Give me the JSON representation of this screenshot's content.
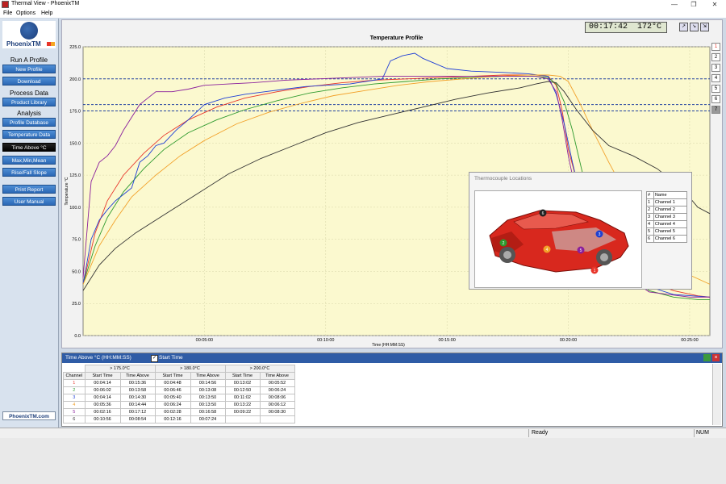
{
  "window": {
    "title": "Thermal View - PhoenixTM",
    "minimize": "—",
    "restore": "❐",
    "close": "✕"
  },
  "menu": [
    "File",
    "Options",
    "Help"
  ],
  "sidebar": {
    "brand": "PhoenixTM",
    "sections": [
      {
        "heading": "Run A Profile",
        "buttons": [
          "New Profile",
          "Download"
        ]
      },
      {
        "heading": "Process Data",
        "buttons": [
          "Product Library"
        ]
      },
      {
        "heading": "Analysis",
        "buttons": [
          "Profile Database",
          "Temperature Data",
          "Time Above °C",
          "Max,Min,Mean",
          "Rise/Fall Slope"
        ]
      },
      {
        "heading": "",
        "buttons": [
          "Print Report",
          "User Manual"
        ]
      }
    ],
    "active_button": "Time Above °C",
    "footer_link": "PhoenixTM.com"
  },
  "readout": {
    "time": "00:17:42",
    "temp": "172°C"
  },
  "channel_buttons": [
    "1",
    "2",
    "3",
    "4",
    "5",
    "6",
    "7"
  ],
  "colors": {
    "ch1": "#e8352a",
    "ch2": "#2e9a2e",
    "ch3": "#1f3fd6",
    "ch4": "#f2a12a",
    "ch5": "#8a1f9c",
    "ch6": "#333333",
    "plot_bg": "#fbf9cf",
    "limit": "#2040a0"
  },
  "chart_data": {
    "type": "line",
    "title": "Temperature Profile",
    "xlabel": "Time (HH:MM:SS)",
    "ylabel": "Temperature °C",
    "xlim": [
      0,
      1550
    ],
    "ylim": [
      0,
      225
    ],
    "x_ticks": [
      "00:05:00",
      "00:10:00",
      "00:15:00",
      "00:20:00",
      "00:25:00"
    ],
    "x_tick_values": [
      300,
      600,
      900,
      1200,
      1500
    ],
    "y_ticks": [
      "0.0",
      "25.0",
      "50.0",
      "75.0",
      "100.0",
      "125.0",
      "150.0",
      "175.0",
      "200.0",
      "225.0"
    ],
    "grid": true,
    "limit_lines": [
      175,
      180,
      200
    ],
    "series": [
      {
        "name": "Channel 1",
        "x": [
          0,
          30,
          60,
          100,
          150,
          200,
          260,
          330,
          400,
          480,
          560,
          640,
          720,
          800,
          880,
          960,
          1040,
          1120,
          1150,
          1170,
          1185,
          1200,
          1230,
          1280,
          1340,
          1400,
          1460,
          1520,
          1550
        ],
        "y": [
          40,
          80,
          105,
          125,
          142,
          156,
          168,
          178,
          185,
          190,
          194,
          197,
          199,
          200,
          201,
          202,
          203,
          203,
          202,
          195,
          175,
          145,
          110,
          75,
          55,
          42,
          35,
          31,
          30
        ]
      },
      {
        "name": "Channel 2",
        "x": [
          0,
          30,
          60,
          100,
          150,
          200,
          260,
          330,
          400,
          480,
          560,
          640,
          720,
          800,
          880,
          960,
          1040,
          1120,
          1150,
          1170,
          1190,
          1210,
          1240,
          1280,
          1340,
          1400,
          1460,
          1520,
          1550
        ],
        "y": [
          40,
          70,
          92,
          112,
          130,
          145,
          158,
          168,
          176,
          183,
          189,
          193,
          196,
          198,
          200,
          201,
          202,
          202,
          201,
          196,
          182,
          160,
          120,
          80,
          50,
          35,
          30,
          28,
          28
        ]
      },
      {
        "name": "Channel 3",
        "x": [
          0,
          20,
          40,
          60,
          80,
          100,
          120,
          140,
          160,
          180,
          200,
          230,
          260,
          300,
          350,
          400,
          450,
          500,
          550,
          600,
          660,
          740,
          760,
          790,
          820,
          840,
          900,
          960,
          1040,
          1100,
          1150,
          1170,
          1190,
          1210,
          1240,
          1300,
          1400,
          1460,
          1550
        ],
        "y": [
          40,
          75,
          90,
          98,
          105,
          110,
          115,
          135,
          140,
          148,
          150,
          160,
          168,
          180,
          185,
          188,
          190,
          192,
          194,
          195,
          196,
          200,
          214,
          218,
          220,
          216,
          208,
          206,
          205,
          204,
          202,
          188,
          165,
          135,
          95,
          55,
          38,
          32,
          30
        ]
      },
      {
        "name": "Channel 4",
        "x": [
          0,
          40,
          80,
          120,
          180,
          240,
          300,
          380,
          460,
          540,
          620,
          700,
          780,
          860,
          940,
          1020,
          1100,
          1150,
          1180,
          1200,
          1230,
          1260,
          1300,
          1360,
          1420,
          1480,
          1550
        ],
        "y": [
          40,
          70,
          90,
          108,
          125,
          140,
          152,
          165,
          174,
          181,
          187,
          191,
          195,
          198,
          200,
          202,
          203,
          203,
          202,
          198,
          180,
          160,
          135,
          100,
          70,
          50,
          40
        ]
      },
      {
        "name": "Channel 5",
        "x": [
          0,
          20,
          40,
          60,
          80,
          100,
          140,
          180,
          220,
          260,
          300,
          360,
          420,
          500,
          580,
          660,
          740,
          820,
          900,
          980,
          1060,
          1120,
          1150,
          1170,
          1185,
          1200,
          1230,
          1300,
          1400,
          1500,
          1550
        ],
        "y": [
          45,
          120,
          135,
          140,
          148,
          160,
          180,
          190,
          190,
          192,
          195,
          196,
          197,
          199,
          200,
          201,
          202,
          202,
          202,
          202,
          202,
          202,
          200,
          190,
          168,
          140,
          95,
          55,
          34,
          30,
          30
        ]
      },
      {
        "name": "Channel 6",
        "x": [
          0,
          40,
          80,
          130,
          200,
          280,
          360,
          440,
          520,
          600,
          680,
          760,
          840,
          920,
          1000,
          1080,
          1120,
          1150,
          1170,
          1190,
          1220,
          1260,
          1300,
          1360,
          1420,
          1480,
          1520,
          1550
        ],
        "y": [
          35,
          55,
          68,
          80,
          94,
          110,
          126,
          138,
          148,
          158,
          166,
          172,
          178,
          184,
          189,
          193,
          196,
          198,
          197,
          190,
          176,
          160,
          148,
          140,
          130,
          115,
          100,
          95
        ]
      }
    ]
  },
  "thermocouple_popup": {
    "title": "Thermocouple Locations",
    "col_num": "#",
    "col_name": "Name",
    "rows": [
      {
        "n": "1",
        "name": "Channel 1"
      },
      {
        "n": "2",
        "name": "Channel 2"
      },
      {
        "n": "3",
        "name": "Channel 3"
      },
      {
        "n": "4",
        "name": "Channel 4"
      },
      {
        "n": "5",
        "name": "Channel 5"
      },
      {
        "n": "6",
        "name": "Channel 6"
      }
    ],
    "markers": [
      "6",
      "3",
      "2",
      "4",
      "5",
      "1"
    ]
  },
  "bottom_panel": {
    "title": "Time Above °C (HH:MM:SS)",
    "start_time_label": "Start Time",
    "group_headers": [
      "> 175.0°C",
      "> 180.0°C",
      "> 200.0°C"
    ],
    "channel_header": "Channel",
    "sub_headers": [
      "Start Time",
      "Time Above"
    ],
    "rows": [
      {
        "ch": "1",
        "v": [
          "00:04:14",
          "00:15:36",
          "00:04:48",
          "00:14:56",
          "00:13:02",
          "00:05:52"
        ]
      },
      {
        "ch": "2",
        "v": [
          "00:06:02",
          "00:13:58",
          "00:06:46",
          "00:13:08",
          "00:12:50",
          "00:06:24"
        ]
      },
      {
        "ch": "3",
        "v": [
          "00:04:14",
          "00:14:30",
          "00:05:40",
          "00:13:50",
          "00:11:02",
          "00:08:06"
        ]
      },
      {
        "ch": "4",
        "v": [
          "00:05:36",
          "00:14:44",
          "00:06:24",
          "00:13:50",
          "00:13:22",
          "00:06:12"
        ]
      },
      {
        "ch": "5",
        "v": [
          "00:02:16",
          "00:17:12",
          "00:02:28",
          "00:16:58",
          "00:09:22",
          "00:08:30"
        ]
      },
      {
        "ch": "6",
        "v": [
          "00:10:56",
          "00:08:54",
          "00:12:16",
          "00:07:24",
          "",
          ""
        ]
      }
    ]
  },
  "status": {
    "ready": "Ready",
    "num": "NUM"
  }
}
